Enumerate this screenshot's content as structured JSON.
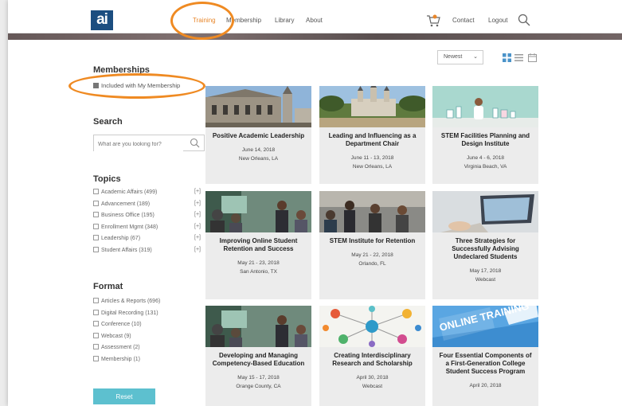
{
  "header": {
    "logo": "ai",
    "nav": {
      "training": "Training",
      "membership": "Membership",
      "library": "Library",
      "about": "About"
    },
    "contact": "Contact",
    "logout": "Logout"
  },
  "sidebar": {
    "memberships_heading": "Memberships",
    "membership_filter": "Included with My Membership",
    "search_heading": "Search",
    "search_placeholder": "What are you looking for?",
    "topics_heading": "Topics",
    "topics": [
      {
        "label": "Academic Affairs (499)",
        "expand": "[+]"
      },
      {
        "label": "Advancement (189)",
        "expand": "[+]"
      },
      {
        "label": "Business Office (195)",
        "expand": "[+]"
      },
      {
        "label": "Enrollment Mgmt (348)",
        "expand": "[+]"
      },
      {
        "label": "Leadership (67)",
        "expand": "[+]"
      },
      {
        "label": "Student Affairs (319)",
        "expand": "[+]"
      }
    ],
    "format_heading": "Format",
    "formats": [
      {
        "label": "Articles & Reports (696)"
      },
      {
        "label": "Digital Recording (131)"
      },
      {
        "label": "Conference (10)"
      },
      {
        "label": "Webcast (9)"
      },
      {
        "label": "Assessment (2)"
      },
      {
        "label": "Membership (1)"
      }
    ],
    "reset_label": "Reset"
  },
  "toolbar": {
    "sort_value": "Newest"
  },
  "cards": [
    {
      "title": "Positive Academic Leadership",
      "date": "June 14, 2018",
      "location": "New Orleans, LA"
    },
    {
      "title": "Leading and Influencing as a Department Chair",
      "date": "June 11 - 13, 2018",
      "location": "New Orleans, LA"
    },
    {
      "title": "STEM Facilities Planning and Design Institute",
      "date": "June 4 - 6, 2018",
      "location": "Virginia Beach, VA"
    },
    {
      "title": "Improving Online Student Retention and Success",
      "date": "May 21 - 23, 2018",
      "location": "San Antonio, TX"
    },
    {
      "title": "STEM Institute for Retention",
      "date": "May 21 - 22, 2018",
      "location": "Orlando, FL"
    },
    {
      "title": "Three Strategies for Successfully Advising Undeclared Students",
      "date": "May 17, 2018",
      "location": "Webcast"
    },
    {
      "title": "Developing and Managing Competency-Based Education",
      "date": "May 15 - 17, 2018",
      "location": "Orange County, CA"
    },
    {
      "title": "Creating Interdisciplinary Research and Scholarship",
      "date": "April 30, 2018",
      "location": "Webcast"
    },
    {
      "title": "Four Essential Components of a First-Generation College Student Success Program",
      "date": "April 20, 2018",
      "location": "",
      "image_text": "ONLINE TRAINING"
    }
  ],
  "colors": {
    "accent": "#e8862a",
    "logo_bg": "#1c4e80",
    "reset_button": "#5dc0cf",
    "card_bg": "#ececec"
  }
}
